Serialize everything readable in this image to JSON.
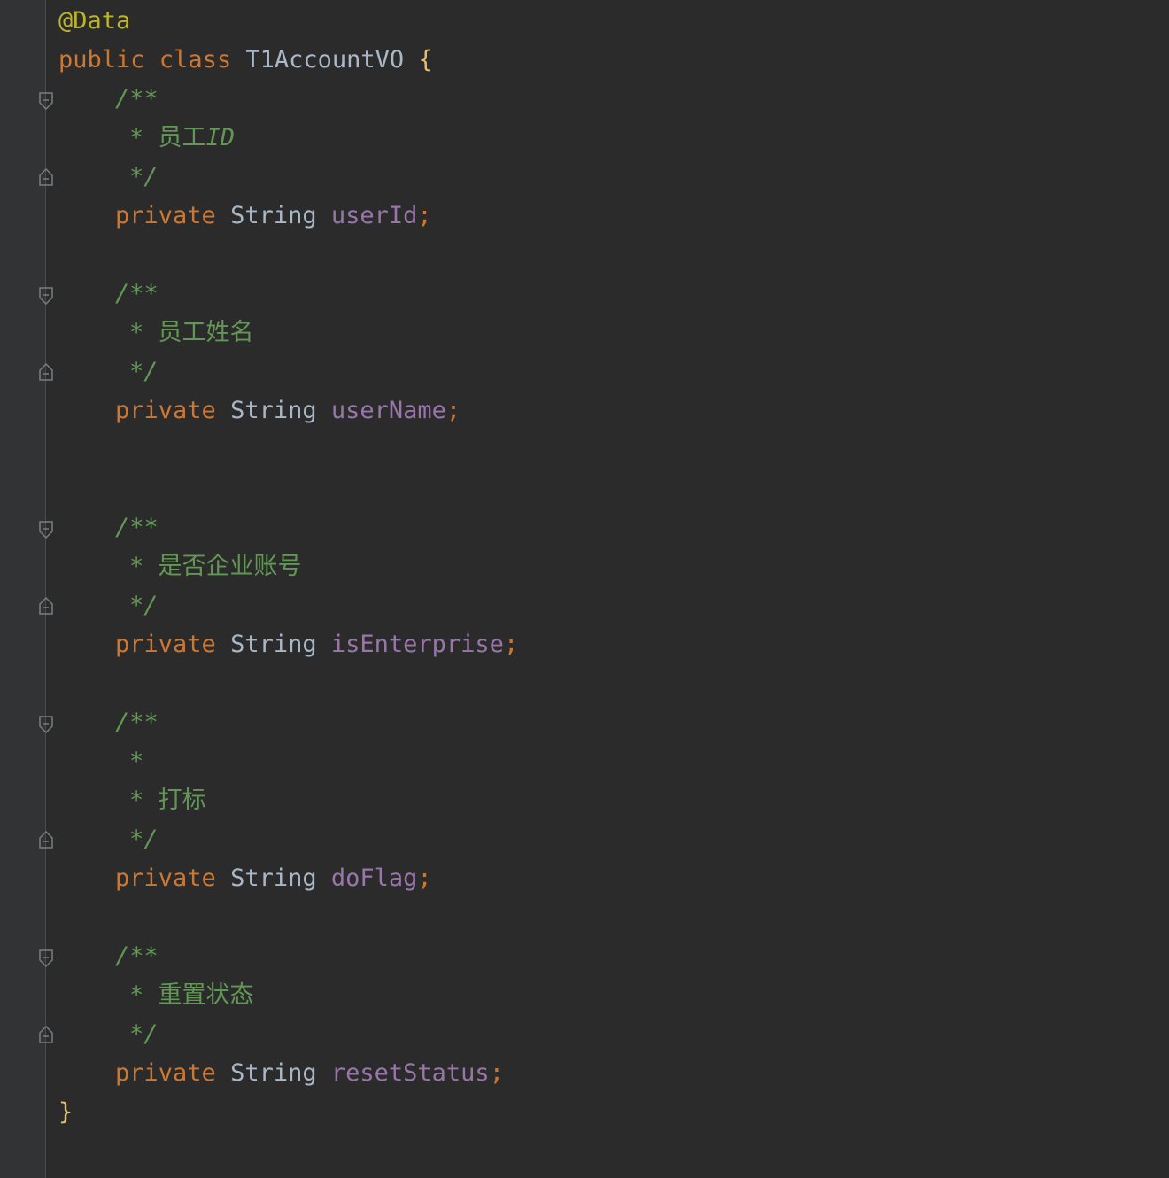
{
  "editor": {
    "annotation": "@Data",
    "class_decl": {
      "kw_public": "public",
      "kw_class": "class",
      "name": "T1AccountVO",
      "open_brace": "{"
    },
    "doc_open": "/**",
    "doc_star": "*",
    "doc_close": "*/",
    "fields": [
      {
        "comment_lines": [
          "员工",
          "ID"
        ],
        "modifier": "private",
        "type": "String",
        "name": "userId",
        "semicolon": ";"
      },
      {
        "comment_lines": [
          "员工姓名"
        ],
        "modifier": "private",
        "type": "String",
        "name": "userName",
        "semicolon": ";"
      },
      {
        "comment_lines": [
          "是否企业账号"
        ],
        "modifier": "private",
        "type": "String",
        "name": "isEnterprise",
        "semicolon": ";"
      },
      {
        "comment_lines": [
          "",
          "打标"
        ],
        "modifier": "private",
        "type": "String",
        "name": "doFlag",
        "semicolon": ";"
      },
      {
        "comment_lines": [
          "重置状态"
        ],
        "modifier": "private",
        "type": "String",
        "name": "resetStatus",
        "semicolon": ";"
      }
    ],
    "close_brace": "}"
  },
  "colors": {
    "background": "#2b2b2b",
    "annotation": "#bbb529",
    "keyword": "#cc7832",
    "field": "#9876aa",
    "doc_comment": "#629755",
    "brace": "#e8bf6a",
    "plain": "#a9b7c6"
  }
}
